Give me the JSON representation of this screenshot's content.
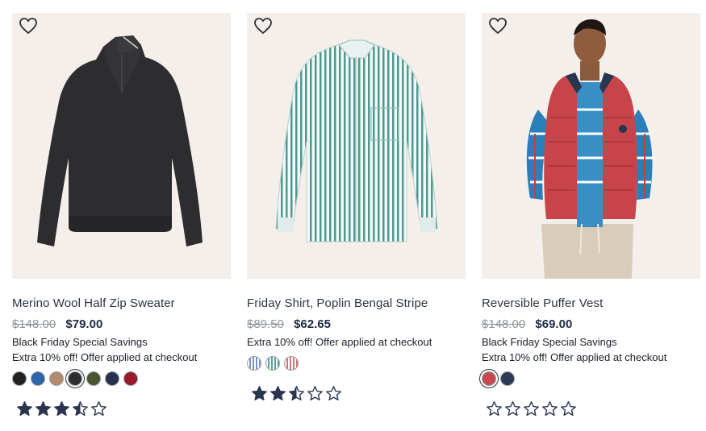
{
  "products": [
    {
      "title": "Merino Wool Half Zip Sweater",
      "original_price": "$148.00",
      "sale_price": "$79.00",
      "promo_line1": "Black Friday Special Savings",
      "promo_line2": "Extra 10% off! Offer applied at checkout",
      "swatch_colors": [
        "#222222",
        "#2e64a8",
        "#b58a6a",
        "#2e2e2e",
        "#4a5430",
        "#27304e",
        "#9a1a2c"
      ],
      "selected_swatch": 3,
      "rating": 3.5
    },
    {
      "title": "Friday Shirt, Poplin Bengal Stripe",
      "original_price": "$89.50",
      "sale_price": "$62.65",
      "promo_line1": "",
      "promo_line2": "Extra 10% off! Offer applied at checkout",
      "swatch_colors": [
        "stripe-blue",
        "stripe-green",
        "stripe-red"
      ],
      "selected_swatch": -1,
      "rating": 2.5
    },
    {
      "title": "Reversible Puffer Vest",
      "original_price": "$148.00",
      "sale_price": "$69.00",
      "promo_line1": "Black Friday Special Savings",
      "promo_line2": "Extra 10% off! Offer applied at checkout",
      "swatch_colors": [
        "#c84a4e",
        "#2b3a55"
      ],
      "selected_swatch": 0,
      "rating": 0
    }
  ],
  "icons": {
    "wishlist": "heart-outline-icon",
    "rating": "star-icon"
  },
  "colors": {
    "star": "#2a3550",
    "price_sale": "#1f2a44",
    "price_original": "#8d929a",
    "image_bg": "#f4efeb"
  }
}
